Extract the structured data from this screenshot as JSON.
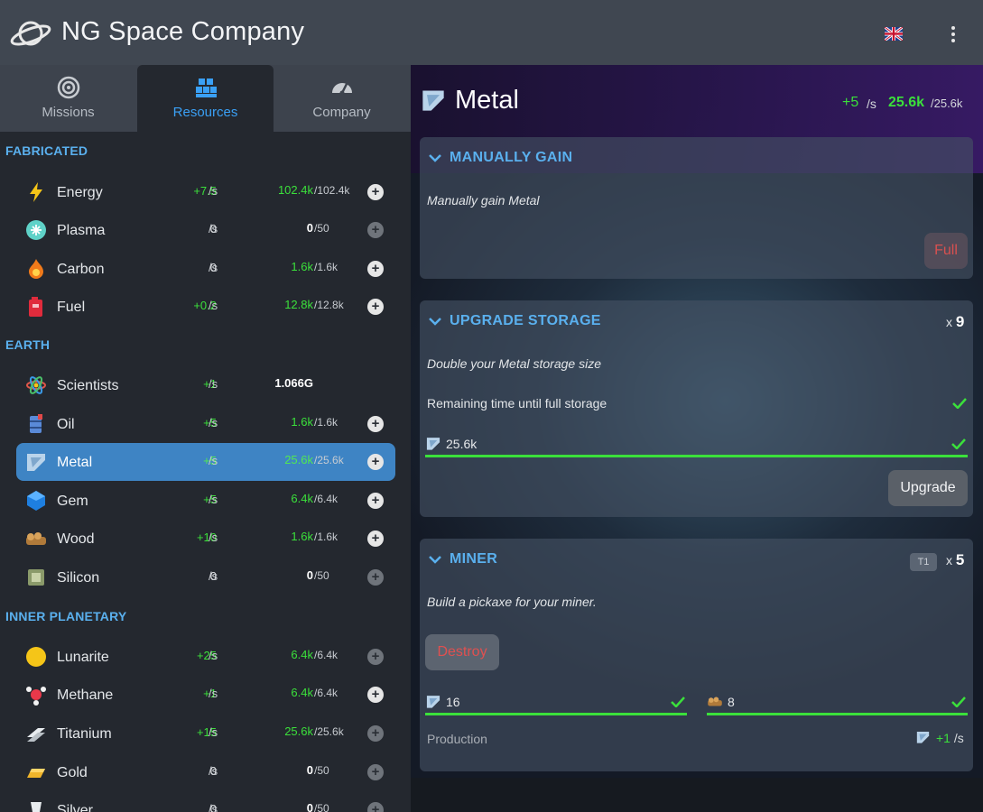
{
  "app": {
    "title": "NG Space Company"
  },
  "tabs": [
    {
      "label": "Missions",
      "icon": "target-icon"
    },
    {
      "label": "Resources",
      "icon": "blocks-icon",
      "active": true
    },
    {
      "label": "Company",
      "icon": "gauge-icon"
    }
  ],
  "sections": {
    "fabricated": "FABRICATED",
    "earth": "EARTH",
    "inner_planetary": "INNER PLANETARY"
  },
  "resources": {
    "energy": {
      "name": "Energy",
      "rate": "+7.5",
      "unit": "/s",
      "amount": "102.4k",
      "cap": "/102.4k"
    },
    "plasma": {
      "name": "Plasma",
      "rate": "0",
      "unit": "/s",
      "amount": "0",
      "cap": "/50"
    },
    "carbon": {
      "name": "Carbon",
      "rate": "0",
      "unit": "/s",
      "amount": "1.6k",
      "cap": "/1.6k"
    },
    "fuel": {
      "name": "Fuel",
      "rate": "+0.2",
      "unit": "/s",
      "amount": "12.8k",
      "cap": "/12.8k"
    },
    "scientists": {
      "name": "Scientists",
      "rate": "+1",
      "unit": "/s",
      "amount": "1.066G",
      "cap": ""
    },
    "oil": {
      "name": "Oil",
      "rate": "+5",
      "unit": "/s",
      "amount": "1.6k",
      "cap": "/1.6k"
    },
    "metal": {
      "name": "Metal",
      "rate": "+5",
      "unit": "/s",
      "amount": "25.6k",
      "cap": "/25.6k"
    },
    "gem": {
      "name": "Gem",
      "rate": "+5",
      "unit": "/s",
      "amount": "6.4k",
      "cap": "/6.4k"
    },
    "wood": {
      "name": "Wood",
      "rate": "+10",
      "unit": "/s",
      "amount": "1.6k",
      "cap": "/1.6k"
    },
    "silicon": {
      "name": "Silicon",
      "rate": "0",
      "unit": "/s",
      "amount": "0",
      "cap": "/50"
    },
    "lunarite": {
      "name": "Lunarite",
      "rate": "+25",
      "unit": "/s",
      "amount": "6.4k",
      "cap": "/6.4k"
    },
    "methane": {
      "name": "Methane",
      "rate": "+1",
      "unit": "/s",
      "amount": "6.4k",
      "cap": "/6.4k"
    },
    "titanium": {
      "name": "Titanium",
      "rate": "+15",
      "unit": "/s",
      "amount": "25.6k",
      "cap": "/25.6k"
    },
    "gold": {
      "name": "Gold",
      "rate": "0",
      "unit": "/s",
      "amount": "0",
      "cap": "/50"
    },
    "silver": {
      "name": "Silver",
      "rate": "0",
      "unit": "/s",
      "amount": "0",
      "cap": "/50"
    }
  },
  "detail": {
    "title": "Metal",
    "rate": "+5",
    "unit": "/s",
    "amount": "25.6k",
    "cap": "/25.6k",
    "manual": {
      "title": "MANUALLY GAIN",
      "description": "Manually gain Metal",
      "button": "Full"
    },
    "storage": {
      "title": "UPGRADE STORAGE",
      "mult_prefix": "x",
      "mult": "9",
      "description": "Double your Metal storage size",
      "remaining_label": "Remaining time until full storage",
      "cost": "25.6k",
      "button": "Upgrade"
    },
    "miner": {
      "title": "MINER",
      "tier": "T1",
      "mult_prefix": "x",
      "mult": "5",
      "description": "Build a pickaxe for your miner.",
      "destroy_button": "Destroy",
      "cost_metal": "16",
      "cost_wood": "8",
      "production_label": "Production",
      "production_rate": "+1",
      "production_unit": "/s"
    }
  },
  "colors": {
    "accent": "#3e84c4",
    "section": "#5ab0ee",
    "positive": "#3be03b",
    "danger": "#d85050"
  }
}
